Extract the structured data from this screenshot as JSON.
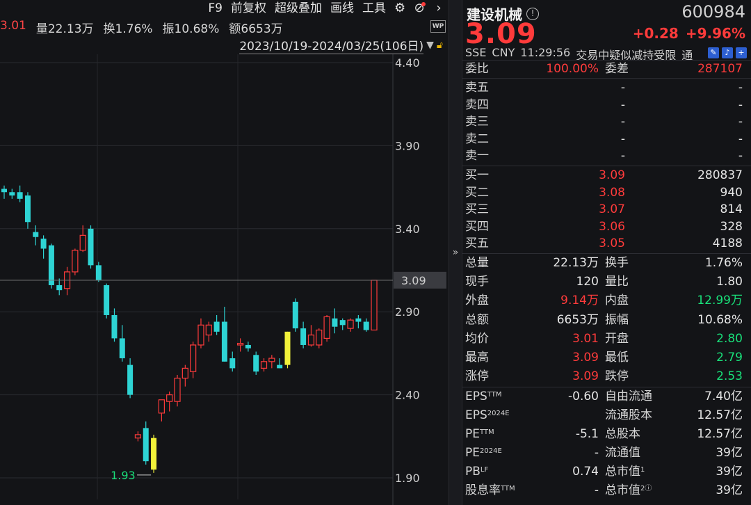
{
  "toolbar": {
    "items": [
      "F9",
      "前复权",
      "超级叠加",
      "画线",
      "工具"
    ],
    "settings_icon": "gear-icon",
    "help_icon": "question-icon",
    "next_icon": "chevron-right-icon"
  },
  "info_row": {
    "partial_price": "3.01",
    "volume": "量22.13万",
    "turnover": "换1.76%",
    "amplitude": "振10.68%",
    "amount": "额6653万"
  },
  "wp_badge": "WP",
  "date_range": "2023/10/19-2024/03/25(106日)",
  "chart": {
    "y_ticks": [
      "4.40",
      "3.90",
      "3.40",
      "2.90",
      "2.40",
      "1.90"
    ],
    "last_price_tag": "3.09",
    "low_label": "1.93",
    "colors": {
      "up": "#ff3b3b",
      "down": "#2ed4d4",
      "highlight": "#f2f23a",
      "bg": "#131417"
    }
  },
  "quote": {
    "name": "建设机械",
    "code": "600984",
    "price": "3.09",
    "change": "+0.28",
    "change_pct": "+9.96%",
    "exchange": "SSE",
    "currency": "CNY",
    "time": "11:29:56",
    "notice": "交易中疑似减持受限",
    "tong": "通",
    "wei_bi_label": "委比",
    "wei_bi": "100.00%",
    "wei_cha_label": "委差",
    "wei_cha": "287107",
    "sells": [
      {
        "label": "卖五",
        "price": "-",
        "vol": "-"
      },
      {
        "label": "卖四",
        "price": "-",
        "vol": "-"
      },
      {
        "label": "卖三",
        "price": "-",
        "vol": "-"
      },
      {
        "label": "卖二",
        "price": "-",
        "vol": "-"
      },
      {
        "label": "卖一",
        "price": "-",
        "vol": "-"
      }
    ],
    "buys": [
      {
        "label": "买一",
        "price": "3.09",
        "vol": "280837"
      },
      {
        "label": "买二",
        "price": "3.08",
        "vol": "940"
      },
      {
        "label": "买三",
        "price": "3.07",
        "vol": "814"
      },
      {
        "label": "买四",
        "price": "3.06",
        "vol": "328"
      },
      {
        "label": "买五",
        "price": "3.05",
        "vol": "4188"
      }
    ],
    "stats": [
      {
        "l1": "总量",
        "v1": "22.13万",
        "c1": "white",
        "l2": "换手",
        "v2": "1.76%",
        "c2": "white"
      },
      {
        "l1": "现手",
        "v1": "120",
        "c1": "white",
        "l2": "量比",
        "v2": "1.80",
        "c2": "white"
      },
      {
        "l1": "外盘",
        "v1": "9.14万",
        "c1": "red",
        "l2": "内盘",
        "v2": "12.99万",
        "c2": "green"
      },
      {
        "l1": "总额",
        "v1": "6653万",
        "c1": "white",
        "l2": "振幅",
        "v2": "10.68%",
        "c2": "white"
      },
      {
        "l1": "均价",
        "v1": "3.01",
        "c1": "red",
        "l2": "开盘",
        "v2": "2.80",
        "c2": "green"
      },
      {
        "l1": "最高",
        "v1": "3.09",
        "c1": "red",
        "l2": "最低",
        "v2": "2.79",
        "c2": "green"
      },
      {
        "l1": "涨停",
        "v1": "3.09",
        "c1": "red",
        "l2": "跌停",
        "v2": "2.53",
        "c2": "green"
      }
    ],
    "fundamentals": [
      {
        "l1": "EPS",
        "s1": "TTM",
        "v1": "-0.60",
        "l2": "自由流通",
        "s2": "",
        "v2": "7.40亿"
      },
      {
        "l1": "EPS",
        "s1": "2024E",
        "v1": "",
        "l2": "流通股本",
        "s2": "",
        "v2": "12.57亿"
      },
      {
        "l1": "PE",
        "s1": "TTM",
        "v1": "-5.1",
        "l2": "总股本",
        "s2": "",
        "v2": "12.57亿"
      },
      {
        "l1": "PE",
        "s1": "2024E",
        "v1": "-",
        "l2": "流通值",
        "s2": "",
        "v2": "39亿"
      },
      {
        "l1": "PB",
        "s1": "LF",
        "v1": "0.74",
        "l2": "总市值",
        "s2": "1",
        "v2": "39亿"
      },
      {
        "l1": "股息率",
        "s1": "TTM",
        "v1": "-",
        "l2": "总市值",
        "s2": "2ⓘ",
        "v2": "39亿"
      }
    ]
  }
}
